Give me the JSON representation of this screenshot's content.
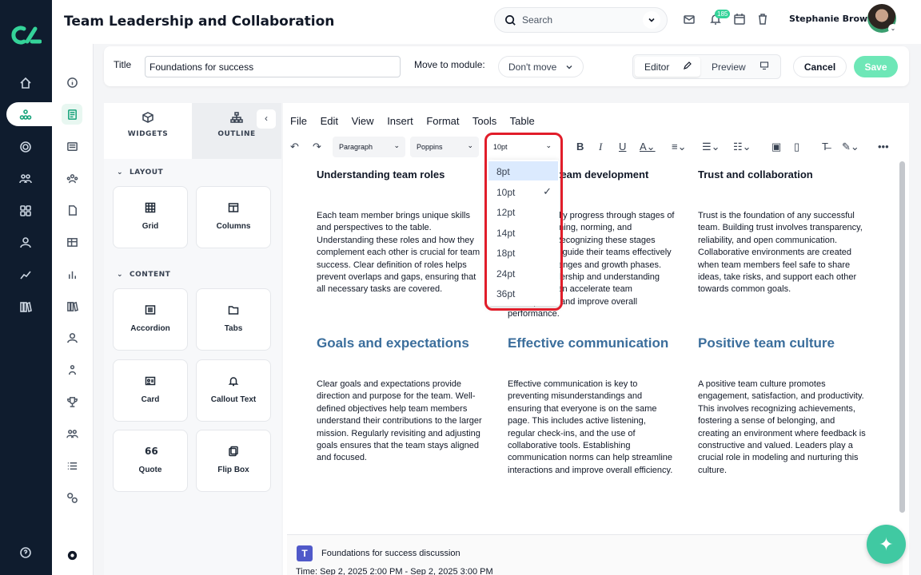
{
  "header": {
    "title": "Team Leadership and Collaboration",
    "search_placeholder": "Search",
    "notification_count": "185",
    "user_name": "Stephanie Brown"
  },
  "title_bar": {
    "title_label": "Title",
    "title_value": "Foundations for success",
    "move_label": "Move to module:",
    "move_value": "Don't move",
    "editor_label": "Editor",
    "preview_label": "Preview",
    "cancel_label": "Cancel",
    "save_label": "Save"
  },
  "widgets_panel": {
    "tabs": [
      "WIDGETS",
      "OUTLINE"
    ],
    "layout_label": "LAYOUT",
    "content_label": "CONTENT",
    "layout_items": [
      "Grid",
      "Columns"
    ],
    "content_items": [
      "Accordion",
      "Tabs",
      "Card",
      "Callout Text",
      "Quote",
      "Flip Box"
    ],
    "quote_glyph": "66"
  },
  "editor": {
    "menu": [
      "File",
      "Edit",
      "View",
      "Insert",
      "Format",
      "Tools",
      "Table"
    ],
    "block_format": "Paragraph",
    "font_family": "Poppins",
    "font_size": "10pt",
    "columns": [
      {
        "heading": "Understanding team roles",
        "body": "Each team member brings unique skills and perspectives to the table. Understanding these roles and how they complement each other is crucial for team success. Clear definition of roles helps prevent overlaps and gaps, ensuring that all necessary tasks are covered."
      },
      {
        "heading": "Stages of team development",
        "body": "Teams typically progress through stages of forming, storming, norming, and performing. Recognizing these stages helps leaders guide their teams effectively through challenges and growth phases. Effective leadership and understanding each stage can accelerate team development and improve overall performance."
      },
      {
        "heading": "Trust and collaboration",
        "body": "Trust is the foundation of any successful team. Building trust involves transparency, reliability, and open communication. Collaborative environments are created when team members feel safe to share ideas, take risks, and support each other towards common goals."
      },
      {
        "heading": "Goals and expectations",
        "body": "Clear goals and expectations provide direction and purpose for the team. Well-defined objectives help team members understand their contributions to the larger mission. Regularly revisiting and adjusting goals ensures that the team stays aligned and focused."
      },
      {
        "heading": "Effective communication",
        "body": "Effective communication is key to preventing misunderstandings and ensuring that everyone is on the same page. This includes active listening, regular check-ins, and the use of collaborative tools. Establishing communication norms can help streamline interactions and improve overall efficiency."
      },
      {
        "heading": "Positive team culture",
        "body": "A positive team culture promotes engagement, satisfaction, and productivity. This involves recognizing achievements, fostering a sense of belonging, and creating an environment where feedback is constructive and valued. Leaders play a crucial role in modeling and nurturing this culture."
      }
    ],
    "teams_title": "Foundations for success discussion",
    "teams_time": "Time: Sep 2, 2025 2:00 PM - Sep 2, 2025 3:00 PM"
  },
  "font_size_dropdown": {
    "options": [
      "8pt",
      "10pt",
      "12pt",
      "14pt",
      "18pt",
      "24pt",
      "36pt"
    ],
    "highlighted": "8pt",
    "selected": "10pt"
  },
  "colors": {
    "rail": "#0f1c2e",
    "accent": "#34d399",
    "heading_blue": "#3b6e9c",
    "highlight_box": "#e11d2a"
  }
}
